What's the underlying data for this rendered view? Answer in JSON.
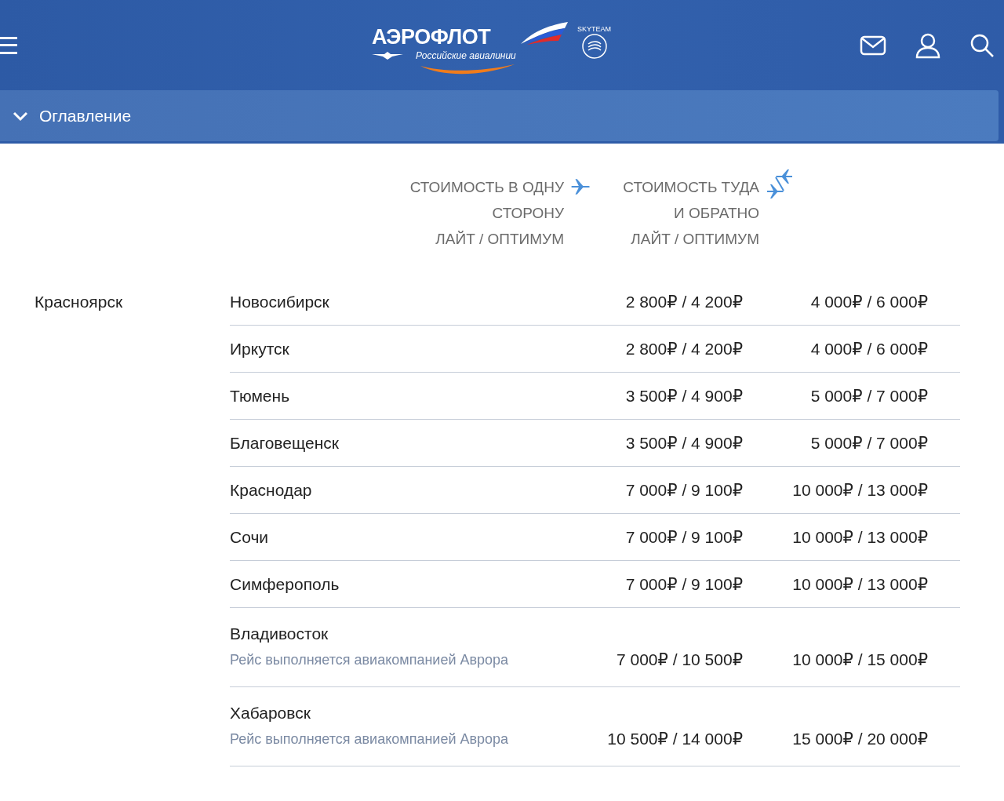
{
  "header": {
    "logo": {
      "name": "АЭРОФЛОТ",
      "tagline": "Российские авиалинии",
      "alliance": "SKYTEAM"
    }
  },
  "contents_bar": {
    "label": "Оглавление",
    "expanded": false
  },
  "table": {
    "origin": "Красноярск",
    "columns": [
      {
        "kind": "one_way",
        "heading": [
          "СТОИМОСТЬ В ОДНУ",
          "СТОРОНУ"
        ],
        "subheading": "ЛАЙТ / ОПТИМУМ"
      },
      {
        "kind": "round_trip",
        "heading": [
          "СТОИМОСТЬ ТУДА",
          "И ОБРАТНО"
        ],
        "subheading": "ЛАЙТ / ОПТИМУМ"
      }
    ],
    "rows": [
      {
        "destination": "Новосибирск",
        "prices": [
          "2 800₽ / 4 200₽",
          "4 000₽ / 6 000₽"
        ]
      },
      {
        "destination": "Иркутск",
        "prices": [
          "2 800₽ / 4 200₽",
          "4 000₽ / 6 000₽"
        ]
      },
      {
        "destination": "Тюмень",
        "prices": [
          "3 500₽ / 4 900₽",
          "5 000₽ / 7 000₽"
        ]
      },
      {
        "destination": "Благовещенск",
        "prices": [
          "3 500₽ / 4 900₽",
          "5 000₽ / 7 000₽"
        ]
      },
      {
        "destination": "Краснодар",
        "prices": [
          "7 000₽ / 9 100₽",
          "10 000₽ / 13 000₽"
        ]
      },
      {
        "destination": "Сочи",
        "prices": [
          "7 000₽ / 9 100₽",
          "10 000₽ / 13 000₽"
        ]
      },
      {
        "destination": "Симферополь",
        "prices": [
          "7 000₽ / 9 100₽",
          "10 000₽ / 13 000₽"
        ]
      },
      {
        "destination": "Владивосток",
        "note": "Рейс выполняется авиакомпанией Аврора",
        "prices": [
          "7 000₽ / 10 500₽",
          "10 000₽ / 15 000₽"
        ]
      },
      {
        "destination": "Хабаровск",
        "note": "Рейс выполняется авиакомпанией Аврора",
        "prices": [
          "10 500₽ / 14 000₽",
          "15 000₽ / 20 000₽"
        ]
      }
    ]
  }
}
